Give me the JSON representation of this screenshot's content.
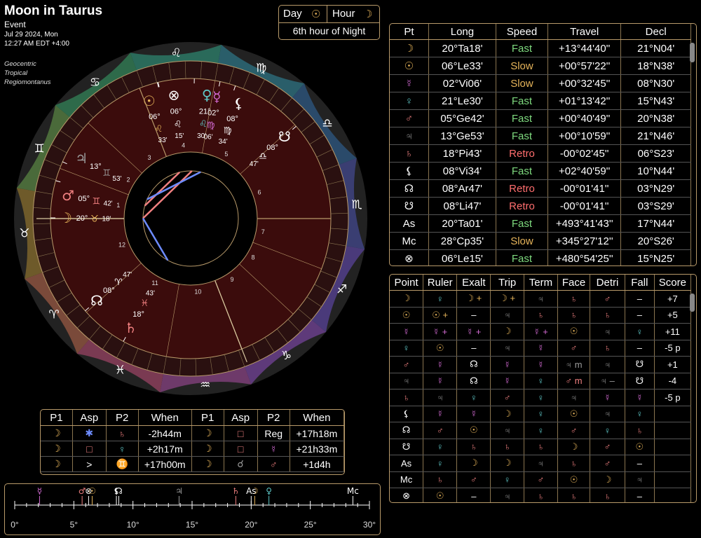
{
  "header": {
    "title": "Moon in Taurus",
    "type": "Event",
    "date": "Jul 29 2024, Mon",
    "time": "12:27 AM EDT +4:00",
    "system": [
      "Geocentric",
      "Tropical",
      "Regiomontanus"
    ]
  },
  "hourbox": {
    "day_label": "Day",
    "day_glyph": "☉",
    "hour_label": "Hour",
    "hour_glyph": "☽",
    "hour_text": "6th hour of Night"
  },
  "colors": {
    "moon": "#e6b45a",
    "sun": "#e6b45a",
    "mercury": "#d46bd4",
    "venus": "#5fc8c8",
    "mars": "#f08080",
    "jupiter": "#9a9a9a",
    "saturn": "#f08080",
    "node": "#ffffff",
    "accent": "#b89a6a",
    "fast": "#7ed97e",
    "slow": "#e6b45a",
    "retro": "#ff6e6e"
  },
  "positions": {
    "headers": [
      "Pt",
      "Long",
      "Speed",
      "Travel",
      "Decl"
    ],
    "rows": [
      {
        "pt": "☽",
        "c": "#e6b45a",
        "long": "20°Ta18'",
        "speed": "Fast",
        "travel": "+13°44'40''",
        "decl": "21°N04'"
      },
      {
        "pt": "☉",
        "c": "#e6b45a",
        "long": "06°Le33'",
        "speed": "Slow",
        "travel": "+00°57'22''",
        "decl": "18°N38'"
      },
      {
        "pt": "☿",
        "c": "#d46bd4",
        "long": "02°Vi06'",
        "speed": "Slow",
        "travel": "+00°32'45''",
        "decl": "08°N30'"
      },
      {
        "pt": "♀",
        "c": "#5fc8c8",
        "long": "21°Le30'",
        "speed": "Fast",
        "travel": "+01°13'42''",
        "decl": "15°N43'"
      },
      {
        "pt": "♂",
        "c": "#f08080",
        "long": "05°Ge42'",
        "speed": "Fast",
        "travel": "+00°40'49''",
        "decl": "20°N38'"
      },
      {
        "pt": "♃",
        "c": "#9a9a9a",
        "long": "13°Ge53'",
        "speed": "Fast",
        "travel": "+00°10'59''",
        "decl": "21°N46'"
      },
      {
        "pt": "♄",
        "c": "#f08080",
        "long": "18°Pi43'",
        "speed": "Retro",
        "travel": "-00°02'45''",
        "decl": "06°S23'"
      },
      {
        "pt": "⚸",
        "c": "#ffffff",
        "long": "08°Vi34'",
        "speed": "Fast",
        "travel": "+02°40'59''",
        "decl": "10°N44'"
      },
      {
        "pt": "☊",
        "c": "#ffffff",
        "long": "08°Ar47'",
        "speed": "Retro",
        "travel": "-00°01'41''",
        "decl": "03°N29'"
      },
      {
        "pt": "☋",
        "c": "#ffffff",
        "long": "08°Li47'",
        "speed": "Retro",
        "travel": "-00°01'41''",
        "decl": "03°S29'"
      },
      {
        "pt": "As",
        "c": "#ffffff",
        "long": "20°Ta01'",
        "speed": "Fast",
        "travel": "+493°41'43''",
        "decl": "17°N44'"
      },
      {
        "pt": "Mc",
        "c": "#ffffff",
        "long": "28°Cp35'",
        "speed": "Slow",
        "travel": "+345°27'12''",
        "decl": "20°S26'"
      },
      {
        "pt": "⊗",
        "c": "#ffffff",
        "long": "06°Le15'",
        "speed": "Fast",
        "travel": "+480°54'25''",
        "decl": "15°N25'"
      }
    ]
  },
  "dignities": {
    "headers": [
      "Point",
      "Ruler",
      "Exalt",
      "Trip",
      "Term",
      "Face",
      "Detri",
      "Fall",
      "Score"
    ],
    "rows": [
      [
        [
          "☽",
          "#e6b45a"
        ],
        [
          "♀",
          "#5fc8c8"
        ],
        [
          "☽ +",
          "#e6b45a"
        ],
        [
          "☽ +",
          "#e6b45a"
        ],
        [
          "♃",
          "#9a9a9a"
        ],
        [
          "♄",
          "#f08080"
        ],
        [
          "♂",
          "#f08080"
        ],
        [
          "–",
          "#ffffff"
        ],
        [
          "+7",
          "#ffffff"
        ]
      ],
      [
        [
          "☉",
          "#e6b45a"
        ],
        [
          "☉ +",
          "#e6b45a"
        ],
        [
          "–",
          "#ffffff"
        ],
        [
          "♃",
          "#9a9a9a"
        ],
        [
          "♄",
          "#f08080"
        ],
        [
          "♄",
          "#f08080"
        ],
        [
          "♄",
          "#f08080"
        ],
        [
          "–",
          "#ffffff"
        ],
        [
          "+5",
          "#ffffff"
        ]
      ],
      [
        [
          "☿",
          "#d46bd4"
        ],
        [
          "☿ +",
          "#d46bd4"
        ],
        [
          "☿ +",
          "#d46bd4"
        ],
        [
          "☽",
          "#e6b45a"
        ],
        [
          "☿ +",
          "#d46bd4"
        ],
        [
          "☉",
          "#e6b45a"
        ],
        [
          "♃",
          "#9a9a9a"
        ],
        [
          "♀",
          "#5fc8c8"
        ],
        [
          "+11",
          "#ffffff"
        ]
      ],
      [
        [
          "♀",
          "#5fc8c8"
        ],
        [
          "☉",
          "#e6b45a"
        ],
        [
          "–",
          "#ffffff"
        ],
        [
          "♃",
          "#9a9a9a"
        ],
        [
          "☿",
          "#d46bd4"
        ],
        [
          "♂",
          "#f08080"
        ],
        [
          "♄",
          "#f08080"
        ],
        [
          "–",
          "#ffffff"
        ],
        [
          "-5 p",
          "#ffffff"
        ]
      ],
      [
        [
          "♂",
          "#f08080"
        ],
        [
          "☿",
          "#d46bd4"
        ],
        [
          "☊",
          "#ffffff"
        ],
        [
          "☿",
          "#d46bd4"
        ],
        [
          "☿",
          "#d46bd4"
        ],
        [
          "♃ m",
          "#9a9a9a"
        ],
        [
          "♃",
          "#9a9a9a"
        ],
        [
          "☋",
          "#ffffff"
        ],
        [
          "+1",
          "#ffffff"
        ]
      ],
      [
        [
          "♃",
          "#9a9a9a"
        ],
        [
          "☿",
          "#d46bd4"
        ],
        [
          "☊",
          "#ffffff"
        ],
        [
          "☿",
          "#d46bd4"
        ],
        [
          "♀",
          "#5fc8c8"
        ],
        [
          "♂ m",
          "#f08080"
        ],
        [
          "♃ –",
          "#9a9a9a"
        ],
        [
          "☋",
          "#ffffff"
        ],
        [
          "-4",
          "#ffffff"
        ]
      ],
      [
        [
          "♄",
          "#f08080"
        ],
        [
          "♃",
          "#9a9a9a"
        ],
        [
          "♀",
          "#5fc8c8"
        ],
        [
          "♂",
          "#f08080"
        ],
        [
          "♀",
          "#5fc8c8"
        ],
        [
          "♃",
          "#9a9a9a"
        ],
        [
          "☿",
          "#d46bd4"
        ],
        [
          "☿",
          "#d46bd4"
        ],
        [
          "-5 p",
          "#ffffff"
        ]
      ],
      [
        [
          "⚸",
          "#ffffff"
        ],
        [
          "☿",
          "#d46bd4"
        ],
        [
          "☿",
          "#d46bd4"
        ],
        [
          "☽",
          "#e6b45a"
        ],
        [
          "♀",
          "#5fc8c8"
        ],
        [
          "☉",
          "#e6b45a"
        ],
        [
          "♃",
          "#9a9a9a"
        ],
        [
          "♀",
          "#5fc8c8"
        ],
        [
          "",
          "#ffffff"
        ]
      ],
      [
        [
          "☊",
          "#ffffff"
        ],
        [
          "♂",
          "#f08080"
        ],
        [
          "☉",
          "#e6b45a"
        ],
        [
          "♃",
          "#9a9a9a"
        ],
        [
          "♀",
          "#5fc8c8"
        ],
        [
          "♂",
          "#f08080"
        ],
        [
          "♀",
          "#5fc8c8"
        ],
        [
          "♄",
          "#f08080"
        ],
        [
          "",
          "#ffffff"
        ]
      ],
      [
        [
          "☋",
          "#ffffff"
        ],
        [
          "♀",
          "#5fc8c8"
        ],
        [
          "♄",
          "#f08080"
        ],
        [
          "♄",
          "#f08080"
        ],
        [
          "♄",
          "#f08080"
        ],
        [
          "☽",
          "#e6b45a"
        ],
        [
          "♂",
          "#f08080"
        ],
        [
          "☉",
          "#e6b45a"
        ],
        [
          "",
          "#ffffff"
        ]
      ],
      [
        [
          "As",
          "#ffffff"
        ],
        [
          "♀",
          "#5fc8c8"
        ],
        [
          "☽",
          "#e6b45a"
        ],
        [
          "☽",
          "#e6b45a"
        ],
        [
          "♃",
          "#9a9a9a"
        ],
        [
          "♄",
          "#f08080"
        ],
        [
          "♂",
          "#f08080"
        ],
        [
          "–",
          "#ffffff"
        ],
        [
          "",
          "#ffffff"
        ]
      ],
      [
        [
          "Mc",
          "#ffffff"
        ],
        [
          "♄",
          "#f08080"
        ],
        [
          "♂",
          "#f08080"
        ],
        [
          "♀",
          "#5fc8c8"
        ],
        [
          "♂",
          "#f08080"
        ],
        [
          "☉",
          "#e6b45a"
        ],
        [
          "☽",
          "#e6b45a"
        ],
        [
          "♃",
          "#9a9a9a"
        ],
        [
          "",
          "#ffffff"
        ]
      ],
      [
        [
          "⊗",
          "#ffffff"
        ],
        [
          "☉",
          "#e6b45a"
        ],
        [
          "–",
          "#ffffff"
        ],
        [
          "♃",
          "#9a9a9a"
        ],
        [
          "♄",
          "#f08080"
        ],
        [
          "♄",
          "#f08080"
        ],
        [
          "♄",
          "#f08080"
        ],
        [
          "–",
          "#ffffff"
        ],
        [
          "",
          "#ffffff"
        ]
      ]
    ]
  },
  "aspects": {
    "headers": [
      "P1",
      "Asp",
      "P2",
      "When",
      "P1",
      "Asp",
      "P2",
      "When"
    ],
    "rows": [
      [
        [
          "☽",
          "#e6b45a"
        ],
        [
          "✱",
          "#6e8cff"
        ],
        [
          "♄",
          "#f08080"
        ],
        [
          "-2h44m",
          "#ffffff"
        ],
        [
          "☽",
          "#e6b45a"
        ],
        [
          "□",
          "#f08080"
        ],
        [
          "Reg",
          "#ffffff"
        ],
        [
          "+17h18m",
          "#ffffff"
        ]
      ],
      [
        [
          "☽",
          "#e6b45a"
        ],
        [
          "□",
          "#f08080"
        ],
        [
          "♀",
          "#5fc8c8"
        ],
        [
          "+2h17m",
          "#ffffff"
        ],
        [
          "☽",
          "#e6b45a"
        ],
        [
          "□",
          "#f08080"
        ],
        [
          "☿",
          "#d46bd4"
        ],
        [
          "+21h33m",
          "#ffffff"
        ]
      ],
      [
        [
          "☽",
          "#e6b45a"
        ],
        [
          ">",
          "#ffffff"
        ],
        [
          "♊",
          "#ffffff"
        ],
        [
          "+17h00m",
          "#ffffff"
        ],
        [
          "☽",
          "#e6b45a"
        ],
        [
          "☌",
          "#9a9a9a"
        ],
        [
          "♂",
          "#f08080"
        ],
        [
          "+1d4h",
          "#ffffff"
        ]
      ]
    ]
  },
  "wheel": {
    "signs": [
      {
        "g": "♈",
        "c": "#f08080"
      },
      {
        "g": "♉",
        "c": "#e6b45a"
      },
      {
        "g": "♊",
        "c": "#8fd0d0"
      },
      {
        "g": "♋",
        "c": "#6e8cff"
      },
      {
        "g": "♌",
        "c": "#f08080"
      },
      {
        "g": "♍",
        "c": "#e6b45a"
      },
      {
        "g": "♎",
        "c": "#8fd0d0"
      },
      {
        "g": "♏",
        "c": "#6e8cff"
      },
      {
        "g": "♐",
        "c": "#f08080"
      },
      {
        "g": "♑",
        "c": "#e6b45a"
      },
      {
        "g": "♒",
        "c": "#8fd0d0"
      },
      {
        "g": "♓",
        "c": "#6e8cff"
      }
    ],
    "house_numbers": [
      "1",
      "2",
      "3",
      "4",
      "5",
      "6",
      "7",
      "8",
      "9",
      "10",
      "11",
      "12"
    ],
    "planets": [
      {
        "g": "☽",
        "c": "#e6b45a",
        "lon": 50.3,
        "deg": "20°",
        "sg": "♉",
        "min": "18'"
      },
      {
        "g": "☉",
        "c": "#e6b45a",
        "lon": 126.55,
        "deg": "06°",
        "sg": "♌",
        "min": "33'"
      },
      {
        "g": "☿",
        "c": "#d46bd4",
        "lon": 152.1,
        "deg": "02°",
        "sg": "♍",
        "min": "06'"
      },
      {
        "g": "♀",
        "c": "#5fc8c8",
        "lon": 141.5,
        "deg": "21°",
        "sg": "♌",
        "min": "30'"
      },
      {
        "g": "♂",
        "c": "#f08080",
        "lon": 65.7,
        "deg": "05°",
        "sg": "♊",
        "min": "42'"
      },
      {
        "g": "♃",
        "c": "#9a9a9a",
        "lon": 73.9,
        "deg": "13°",
        "sg": "♊",
        "min": "53'"
      },
      {
        "g": "♄",
        "c": "#f08080",
        "lon": 348.7,
        "deg": "18°",
        "sg": "♓",
        "min": "43'"
      },
      {
        "g": "⚸",
        "c": "#ffffff",
        "lon": 158.6,
        "deg": "08°",
        "sg": "♍",
        "min": "34'"
      },
      {
        "g": "☊",
        "c": "#ffffff",
        "lon": 8.8,
        "deg": "08°",
        "sg": "♈",
        "min": "47'"
      },
      {
        "g": "☋",
        "c": "#ffffff",
        "lon": 188.8,
        "deg": "08°",
        "sg": "♎",
        "min": "47'"
      },
      {
        "g": "⊗",
        "c": "#ffffff",
        "lon": 126.25,
        "deg": "06°",
        "sg": "♌",
        "min": "15'"
      }
    ],
    "asc_lon": 50.0,
    "mc_lon": 298.6
  },
  "timeline": {
    "ticks": [
      "0°",
      "5°",
      "10°",
      "15°",
      "20°",
      "25°",
      "30°"
    ],
    "points": [
      {
        "g": "☿",
        "c": "#d46bd4",
        "v": 2.1
      },
      {
        "g": "♂",
        "c": "#f08080",
        "v": 5.7
      },
      {
        "g": "⊗",
        "c": "#ffffff",
        "v": 6.25
      },
      {
        "g": "☉",
        "c": "#e6b45a",
        "v": 6.55
      },
      {
        "g": "⚸",
        "c": "#ffffff",
        "v": 8.6
      },
      {
        "g": "☊",
        "c": "#ffffff",
        "v": 8.8
      },
      {
        "g": "♃",
        "c": "#9a9a9a",
        "v": 13.9
      },
      {
        "g": "♄",
        "c": "#f08080",
        "v": 18.7
      },
      {
        "g": "As",
        "c": "#ffffff",
        "v": 20.0
      },
      {
        "g": "☽",
        "c": "#e6b45a",
        "v": 20.3
      },
      {
        "g": "♀",
        "c": "#5fc8c8",
        "v": 21.5
      },
      {
        "g": "Mc",
        "c": "#ffffff",
        "v": 28.6
      }
    ]
  }
}
